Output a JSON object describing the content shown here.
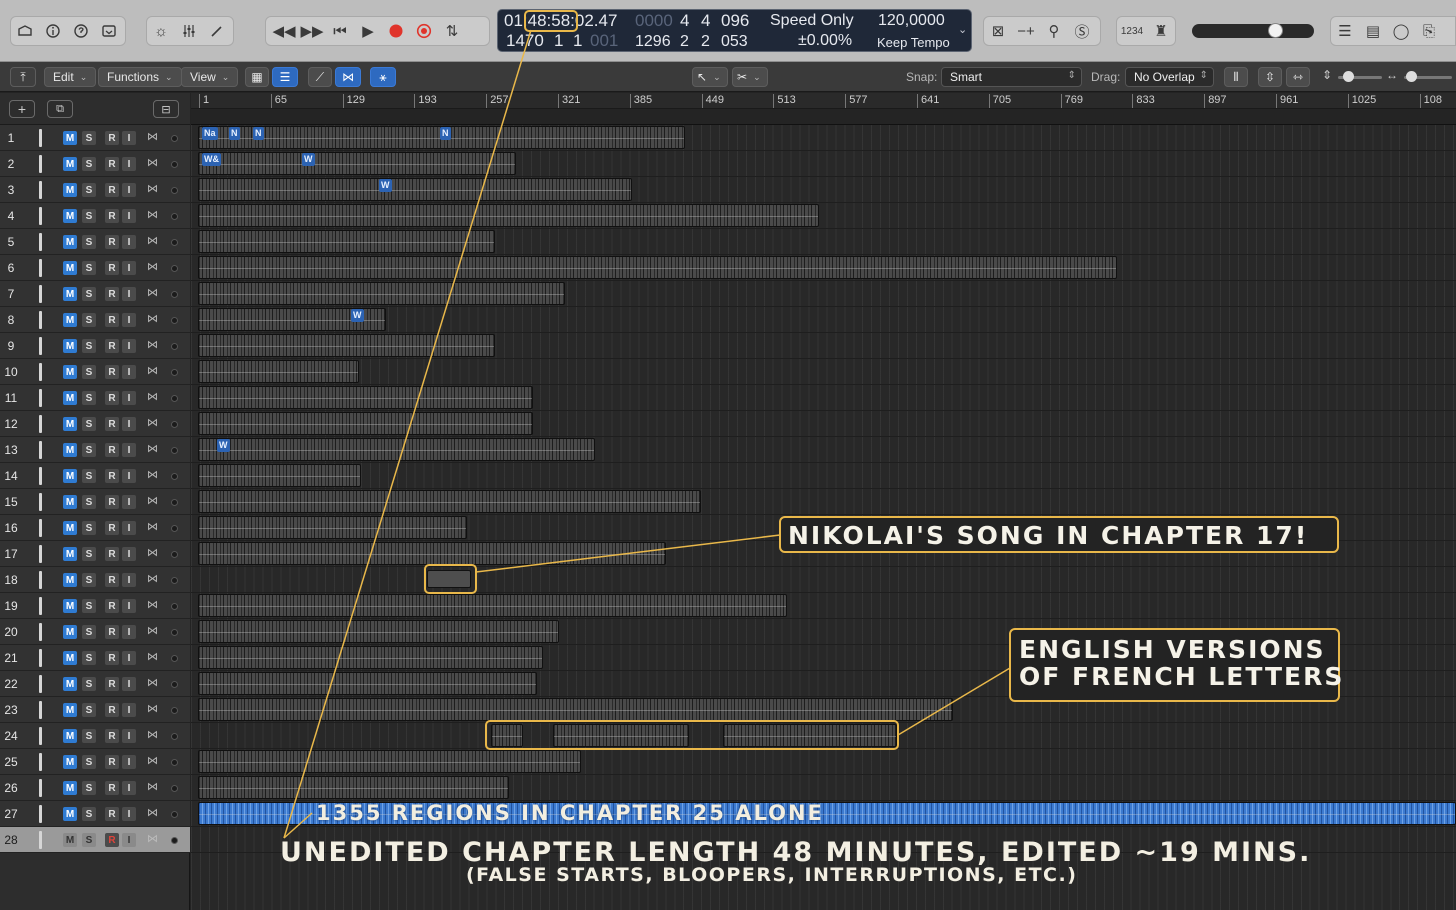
{
  "lcd": {
    "time_main": "01:48:58:02.47",
    "time_sub_bar": "0000",
    "time_sub_beat": "4",
    "time_sub_div": "4",
    "time_sub_tick": "096",
    "bar": "1470",
    "beat": "1",
    "div": "1",
    "tick_dim": "001",
    "end_bar": "1296",
    "end_beat": "2",
    "end_div": "2",
    "end_tick": "053",
    "speed_mode": "Speed Only",
    "speed_value": "±0.00%",
    "tempo": "120,0000",
    "tempo_mode": "Keep Tempo",
    "lcd_dropdown_icon": "chevron-down-icon"
  },
  "count_in_label": "1234",
  "toolbar": {
    "edit_label": "Edit",
    "functions_label": "Functions",
    "view_label": "View",
    "snap_label": "Snap:",
    "snap_value": "Smart",
    "drag_label": "Drag:",
    "drag_value": "No Overlap"
  },
  "ruler": [
    "1",
    "65",
    "129",
    "193",
    "257",
    "321",
    "385",
    "449",
    "513",
    "577",
    "641",
    "705",
    "769",
    "833",
    "897",
    "961",
    "1025",
    "108"
  ],
  "track_buttons": {
    "m": "M",
    "s": "S",
    "r": "R",
    "i": "I"
  },
  "tracks": [
    {
      "num": "1"
    },
    {
      "num": "2"
    },
    {
      "num": "3"
    },
    {
      "num": "4"
    },
    {
      "num": "5"
    },
    {
      "num": "6"
    },
    {
      "num": "7"
    },
    {
      "num": "8"
    },
    {
      "num": "9"
    },
    {
      "num": "10"
    },
    {
      "num": "11"
    },
    {
      "num": "12"
    },
    {
      "num": "13"
    },
    {
      "num": "14"
    },
    {
      "num": "15"
    },
    {
      "num": "16"
    },
    {
      "num": "17"
    },
    {
      "num": "18"
    },
    {
      "num": "19"
    },
    {
      "num": "20"
    },
    {
      "num": "21"
    },
    {
      "num": "22"
    },
    {
      "num": "23"
    },
    {
      "num": "24"
    },
    {
      "num": "25"
    },
    {
      "num": "26"
    },
    {
      "num": "27"
    },
    {
      "num": "28"
    }
  ],
  "region_tags": {
    "t1a": "Na",
    "t1b": "N",
    "t1c": "N",
    "t1d": "N",
    "t2a": "W&",
    "t2b": "W",
    "t3a": "W",
    "t8a": "W",
    "t13a": "W"
  },
  "annotations": {
    "nikolai": "NIKOLAI'S SONG IN CHAPTER 17!",
    "english_line1": "ENGLISH VERSIONS",
    "english_line2": "OF FRENCH LETTERS",
    "regions": "1355 REGIONS IN CHAPTER 25 ALONE",
    "unedited": "UNEDITED CHAPTER LENGTH 48 MINUTES, EDITED ~19 MINS.",
    "unedited_sub": "(FALSE STARTS, BLOOPERS, INTERRUPTIONS, ETC.)"
  },
  "colors": {
    "accent_blue": "#2f7bd2",
    "annotation_gold": "#e9b84a",
    "record_red": "#e0342b"
  }
}
